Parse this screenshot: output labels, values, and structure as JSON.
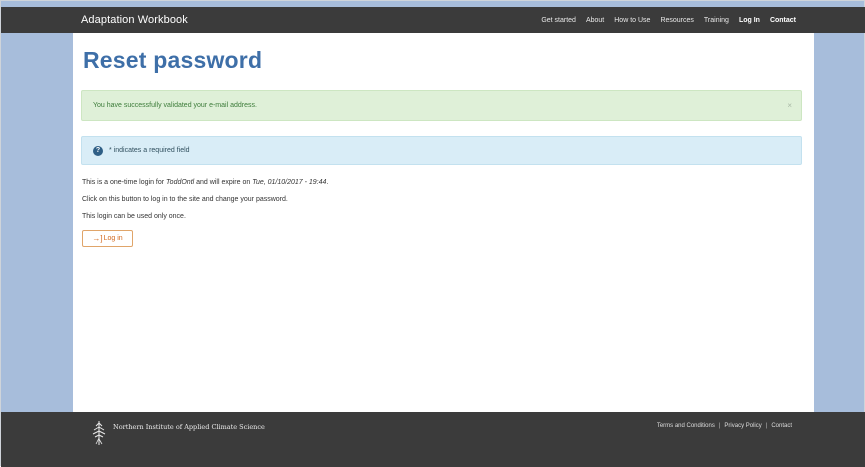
{
  "header": {
    "brand": "Adaptation Workbook",
    "nav": [
      {
        "label": "Get started",
        "bold": false
      },
      {
        "label": "About",
        "bold": false
      },
      {
        "label": "How to Use",
        "bold": false
      },
      {
        "label": "Resources",
        "bold": false
      },
      {
        "label": "Training",
        "bold": false
      },
      {
        "label": "Log In",
        "bold": true
      },
      {
        "label": "Contact",
        "bold": true
      }
    ]
  },
  "page": {
    "title": "Reset password",
    "success_message": "You have successfully validated your e-mail address.",
    "close_symbol": "×",
    "info_icon": "question-circle-icon",
    "info_message": "* indicates a required field",
    "line1_prefix": "This is a one-time login for ",
    "line1_user": "ToddOntl",
    "line1_middle": " and will expire on ",
    "line1_date": "Tue, 01/10/2017 - 19:44",
    "line1_suffix": ".",
    "line2": "Click on this button to log in to the site and change your password.",
    "line3": "This login can be used only once.",
    "login_button": "Log in",
    "login_icon": "log-in-icon"
  },
  "footer": {
    "org": "Northern Institute of Applied Climate Science",
    "links": [
      "Terms and Conditions",
      "Privacy Policy",
      "Contact"
    ],
    "separator": "|"
  },
  "colors": {
    "nav_bg": "#3b3b3b",
    "side_bg": "#a7bddb",
    "title": "#3e6fa8",
    "success_bg": "#dff0d8",
    "info_bg": "#d9edf7",
    "button_accent": "#d2691e"
  }
}
